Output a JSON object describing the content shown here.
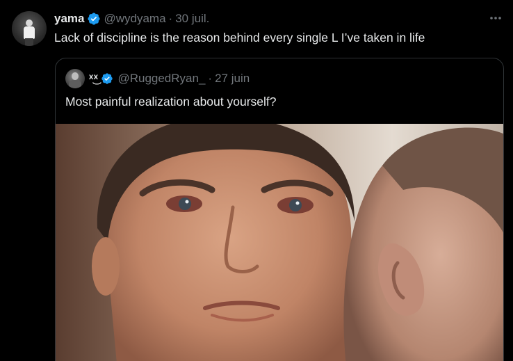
{
  "tweet": {
    "author_name": "yama",
    "author_handle": "@wydyama",
    "separator": "·",
    "date": "30 juil.",
    "text": "Lack of discipline is the reason behind every single L I’ve taken in life",
    "more_icon": "ellipsis-icon"
  },
  "quote": {
    "author_name": "ˣ͜ˣ",
    "author_handle": "@RuggedRyan_",
    "separator": "·",
    "date": "27 juin",
    "text": "Most painful realization about yourself?"
  },
  "colors": {
    "background": "#000000",
    "text_primary": "#e7e9ea",
    "text_secondary": "#71767b",
    "verified_blue": "#1d9bf0",
    "border": "#2f3336"
  }
}
